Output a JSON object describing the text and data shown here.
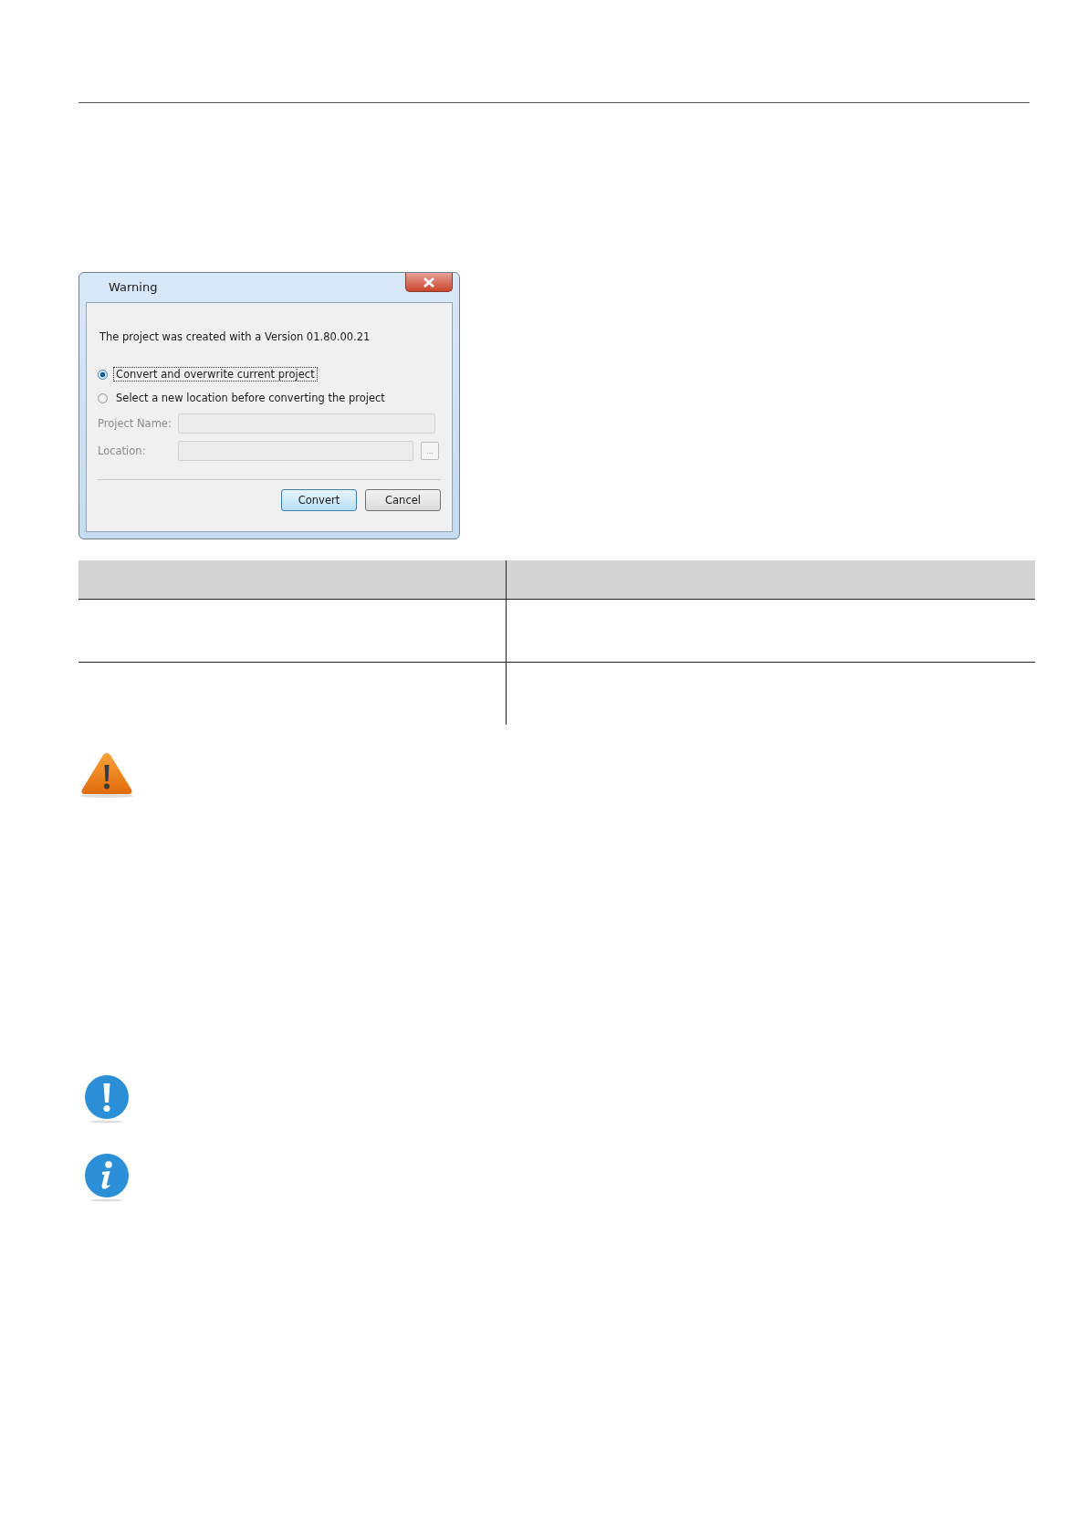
{
  "dialog": {
    "title": "Warning",
    "message": "The project was created with a Version 01.80.00.21",
    "options": [
      {
        "label": "Convert and overwrite current project",
        "selected": true
      },
      {
        "label": "Select a new location before converting the project",
        "selected": false
      }
    ],
    "fields": [
      {
        "label": "Project Name:",
        "disabled": true
      },
      {
        "label": "Location:",
        "disabled": true,
        "browse": "..."
      }
    ],
    "buttons": [
      {
        "label": "Convert",
        "default": true
      },
      {
        "label": "Cancel",
        "default": false
      }
    ]
  }
}
